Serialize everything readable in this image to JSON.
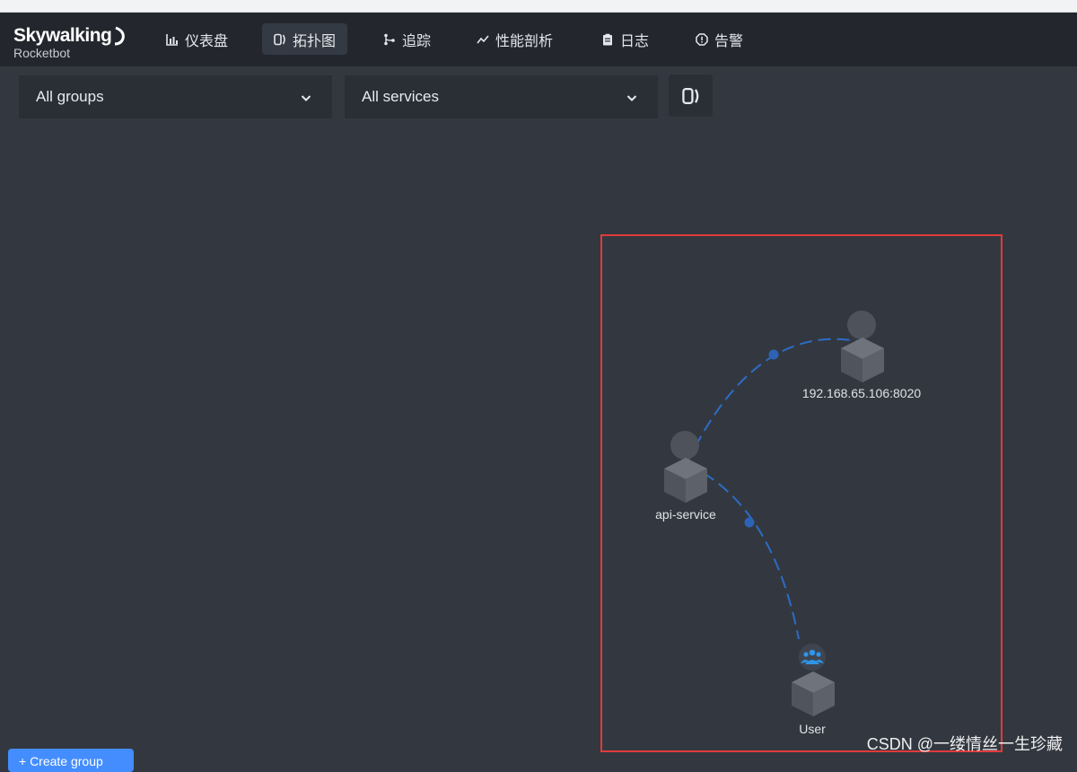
{
  "brand": {
    "title": "Skywalking",
    "subtitle": "Rocketbot"
  },
  "nav": {
    "items": [
      {
        "label": "仪表盘",
        "icon": "chart-bar-icon"
      },
      {
        "label": "拓扑图",
        "icon": "topology-icon",
        "active": true
      },
      {
        "label": "追踪",
        "icon": "branch-icon"
      },
      {
        "label": "性能剖析",
        "icon": "trend-line-icon"
      },
      {
        "label": "日志",
        "icon": "clipboard-icon"
      },
      {
        "label": "告警",
        "icon": "alert-octagon-icon"
      }
    ]
  },
  "filters": {
    "group_select": {
      "value": "All groups"
    },
    "service_select": {
      "value": "All services"
    }
  },
  "topology": {
    "nodes": [
      {
        "name": "192.168.65.106:8020",
        "type": "remote"
      },
      {
        "name": "api-service",
        "type": "service"
      },
      {
        "name": "User",
        "type": "user"
      }
    ],
    "link_color": "#2d6cc6"
  },
  "footer": {
    "create_group_label": "+ Create group"
  },
  "watermark": "CSDN @一缕情丝一生珍藏",
  "colors": {
    "accent": "#448dfe",
    "highlight_border": "#e23a3a",
    "background": "#333840",
    "navbar": "#23272d"
  }
}
